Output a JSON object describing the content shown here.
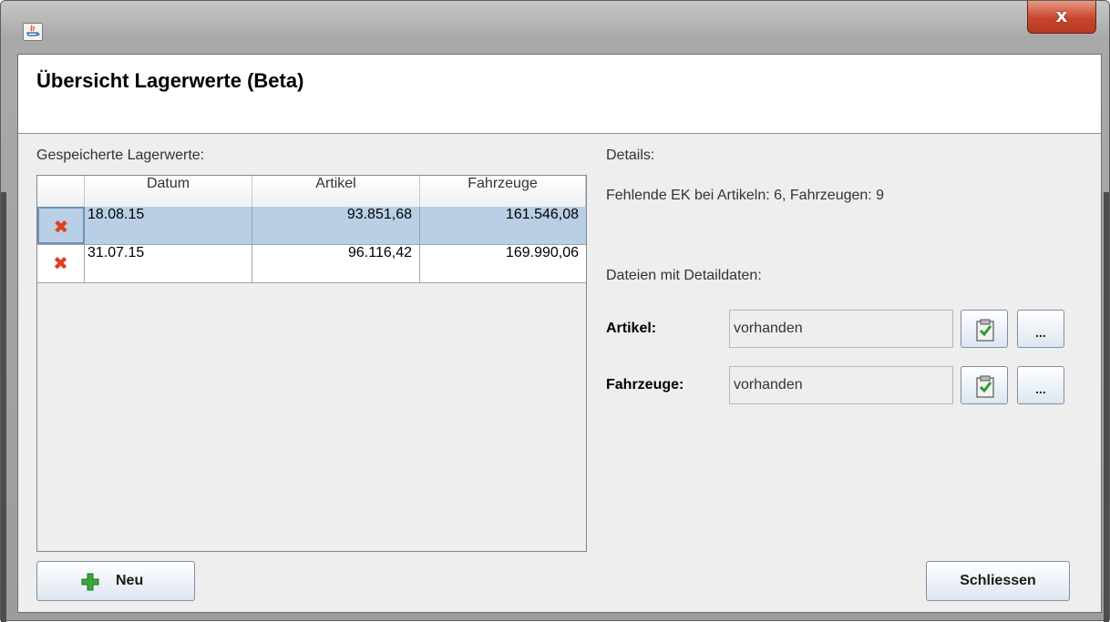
{
  "window": {
    "close_symbol": "x",
    "app_icon": "java-icon"
  },
  "header": {
    "title": "Übersicht Lagerwerte (Beta)"
  },
  "left": {
    "section_label": "Gespeicherte Lagerwerte:",
    "columns": [
      "",
      "Datum",
      "Artikel",
      "Fahrzeuge"
    ],
    "rows": [
      {
        "datum": "18.08.15",
        "artikel": "93.851,68",
        "fahrzeuge": "161.546,08",
        "selected": true,
        "delete_icon": "delete-x-icon"
      },
      {
        "datum": "31.07.15",
        "artikel": "96.116,42",
        "fahrzeuge": "169.990,06",
        "selected": false,
        "delete_icon": "delete-x-icon"
      }
    ],
    "new_button_label": "Neu",
    "new_button_icon": "add-plus-icon"
  },
  "right": {
    "details_label": "Details:",
    "missing_info": "Fehlende EK bei Artikeln: 6, Fahrzeugen: 9",
    "files_label": "Dateien mit Detaildaten:",
    "artikel_label": "Artikel:",
    "artikel_value": "vorhanden",
    "fahrzeuge_label": "Fahrzeuge:",
    "fahrzeuge_value": "vorhanden",
    "open_icon": "clipboard-check-icon",
    "browse_label": "..."
  },
  "footer": {
    "close_button_label": "Schliessen"
  },
  "colors": {
    "selection": "#b8cfe5",
    "delete_icon": "#e0401e",
    "plus_icon": "#3aa83a",
    "close_button": "#c8442d"
  }
}
